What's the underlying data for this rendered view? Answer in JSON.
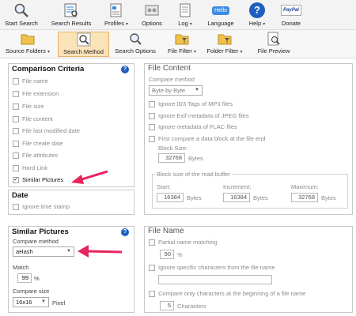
{
  "toolbar": {
    "start_search": "Start Search",
    "search_results": "Search Results",
    "profiles": "Profiles",
    "options": "Options",
    "log": "Log",
    "language": "Language",
    "help": "Help",
    "donate": "Donate",
    "language_badge": "Hello",
    "donate_badge": "PayPal"
  },
  "tabs": {
    "source_folders": "Source Folders",
    "search_method": "Search Method",
    "search_options": "Search Options",
    "file_filter": "File Filter",
    "folder_filter": "Folder Filter",
    "file_preview": "File Preview"
  },
  "comparison": {
    "title": "Comparison Criteria",
    "items": [
      {
        "label": "File name",
        "checked": false
      },
      {
        "label": "File extension",
        "checked": false
      },
      {
        "label": "File size",
        "checked": false
      },
      {
        "label": "File content",
        "checked": false
      },
      {
        "label": "File last modified date",
        "checked": false
      },
      {
        "label": "File create date",
        "checked": false
      },
      {
        "label": "File attributes",
        "checked": false
      },
      {
        "label": "Hard Link",
        "checked": false
      },
      {
        "label": "Similar Pictures",
        "checked": true
      }
    ]
  },
  "date": {
    "title": "Date",
    "ignore_time_stamp": "Ignore time stamp"
  },
  "similar": {
    "title": "Similar Pictures",
    "compare_method_label": "Compare method",
    "compare_method_value": "aHash",
    "match_label": "Match",
    "match_value": "99",
    "match_unit": "%",
    "compare_size_label": "Compare size",
    "compare_size_value": "16x16",
    "compare_size_unit": "Pixel"
  },
  "file_content": {
    "title": "File Content",
    "compare_method_label": "Compare method",
    "compare_method_value": "Byte by Byte",
    "ignore_id3": "Ignore ID3 Tags of MP3 files",
    "ignore_exif": "Ignore Exif metadata of JPEG files",
    "ignore_flac": "Ignore metadata of FLAC files",
    "first_compare": "First compare a data block at the file end",
    "block_size_label": "Block Size:",
    "block_size_value": "32768",
    "block_size_unit": "Bytes",
    "read_buffer_title": "Block size of the read buffer",
    "start_label": "Start:",
    "start_value": "16384",
    "increment_label": "Increment:",
    "increment_value": "16384",
    "maximum_label": "Maximum:",
    "maximum_value": "32768",
    "bytes": "Bytes"
  },
  "file_name": {
    "title": "File Name",
    "partial_matching": "Partial name matching",
    "partial_value": "90",
    "partial_unit": "%",
    "ignore_specific": "Ignore specific characters from the file name",
    "compare_only": "Compare only characters at the beginning of a file name",
    "characters_value": "5",
    "characters_unit": "Characters"
  },
  "colors": {
    "accent_arrow": "#e8245e",
    "help_blue": "#1f5fbf",
    "active_tab": "#fbe3b8"
  }
}
